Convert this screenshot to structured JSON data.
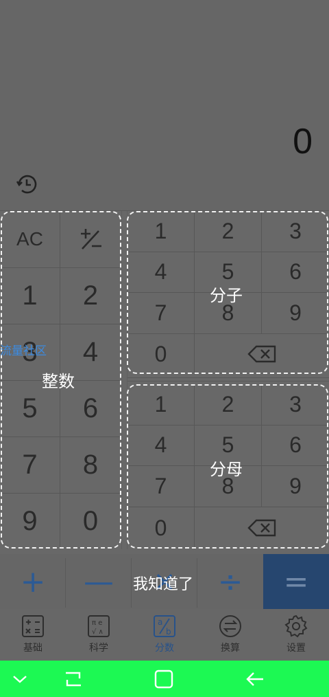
{
  "display": {
    "value": "0"
  },
  "integer_pad": {
    "region_label": "整数",
    "keys": [
      "AC",
      "+/-",
      "1",
      "2",
      "3",
      "4",
      "5",
      "6",
      "7",
      "8",
      "9",
      "0"
    ]
  },
  "numerator_pad": {
    "region_label": "分子",
    "keys": [
      "1",
      "2",
      "3",
      "4",
      "5",
      "6",
      "7",
      "8",
      "9",
      "0"
    ]
  },
  "denominator_pad": {
    "region_label": "分母",
    "keys": [
      "1",
      "2",
      "3",
      "4",
      "5",
      "6",
      "7",
      "8",
      "9",
      "0"
    ]
  },
  "operators": {
    "plus": "+",
    "minus": "—",
    "divide": "÷",
    "equals": "="
  },
  "hint": {
    "dismiss": "我知道了"
  },
  "watermark": "流量社区",
  "tabs": [
    {
      "label": "基础",
      "icon": "basic-calc-icon"
    },
    {
      "label": "科学",
      "icon": "scientific-icon"
    },
    {
      "label": "分数",
      "icon": "fraction-icon",
      "active": true
    },
    {
      "label": "换算",
      "icon": "convert-icon"
    },
    {
      "label": "设置",
      "icon": "settings-gear-icon"
    }
  ],
  "colors": {
    "accent": "#27528a",
    "nav_bar": "#1cf953",
    "overlay_bg": "#666666"
  }
}
